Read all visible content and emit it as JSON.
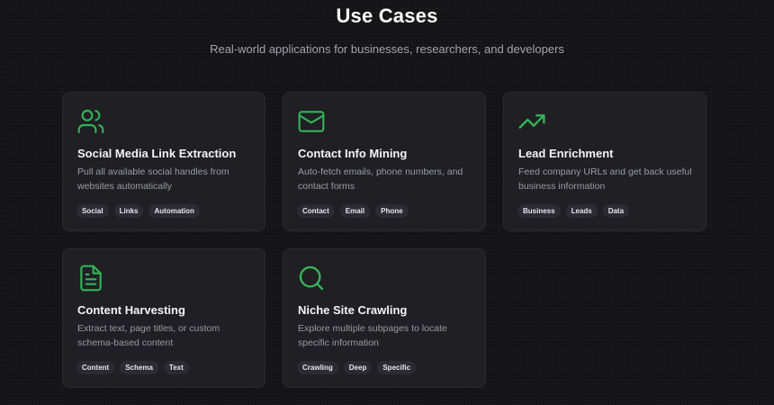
{
  "header": {
    "title": "Use Cases",
    "subtitle": "Real-world applications for businesses, researchers, and developers"
  },
  "accent_color": "#34b358",
  "cards": [
    {
      "icon": "users-icon",
      "title": "Social Media Link Extraction",
      "description": "Pull all available social handles from websites automatically",
      "tags": [
        "Social",
        "Links",
        "Automation"
      ]
    },
    {
      "icon": "mail-icon",
      "title": "Contact Info Mining",
      "description": "Auto-fetch emails, phone numbers, and contact forms",
      "tags": [
        "Contact",
        "Email",
        "Phone"
      ]
    },
    {
      "icon": "trending-up-icon",
      "title": "Lead Enrichment",
      "description": "Feed company URLs and get back useful business information",
      "tags": [
        "Business",
        "Leads",
        "Data"
      ]
    },
    {
      "icon": "document-icon",
      "title": "Content Harvesting",
      "description": "Extract text, page titles, or custom schema-based content",
      "tags": [
        "Content",
        "Schema",
        "Text"
      ]
    },
    {
      "icon": "search-icon",
      "title": "Niche Site Crawling",
      "description": "Explore multiple subpages to locate specific information",
      "tags": [
        "Crawling",
        "Deep",
        "Specific"
      ]
    }
  ]
}
